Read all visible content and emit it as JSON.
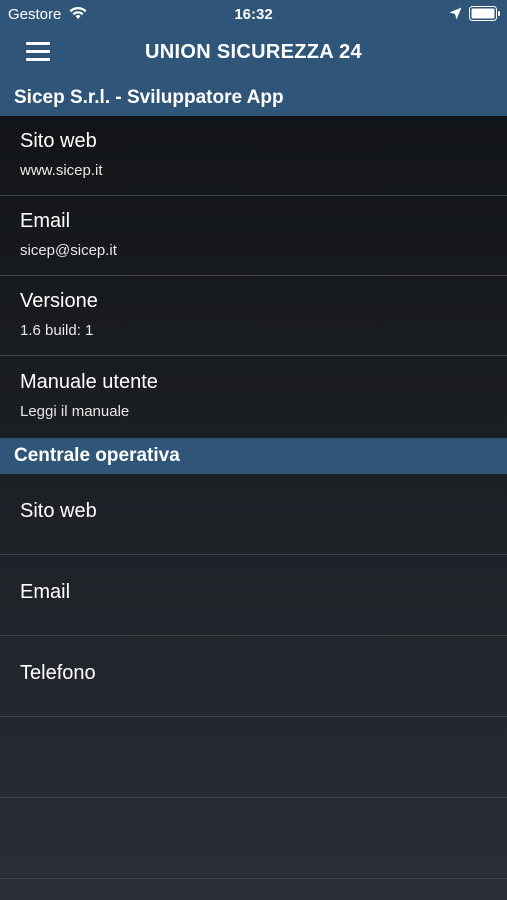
{
  "status_bar": {
    "carrier": "Gestore",
    "time": "16:32"
  },
  "nav": {
    "title": "UNION SICUREZZA 24"
  },
  "sections": [
    {
      "header": "Sicep S.r.l. - Sviluppatore App",
      "rows": [
        {
          "title": "Sito web",
          "subtitle": "www.sicep.it"
        },
        {
          "title": "Email",
          "subtitle": "sicep@sicep.it"
        },
        {
          "title": "Versione",
          "subtitle": "1.6  build: 1"
        },
        {
          "title": "Manuale utente",
          "subtitle": "Leggi il manuale"
        }
      ]
    },
    {
      "header": "Centrale operativa",
      "rows": [
        {
          "title": "Sito web"
        },
        {
          "title": "Email"
        },
        {
          "title": "Telefono"
        }
      ]
    }
  ],
  "colors": {
    "bar": "#2f5678",
    "background": "#1c1f24",
    "separator": "#3d4148"
  }
}
